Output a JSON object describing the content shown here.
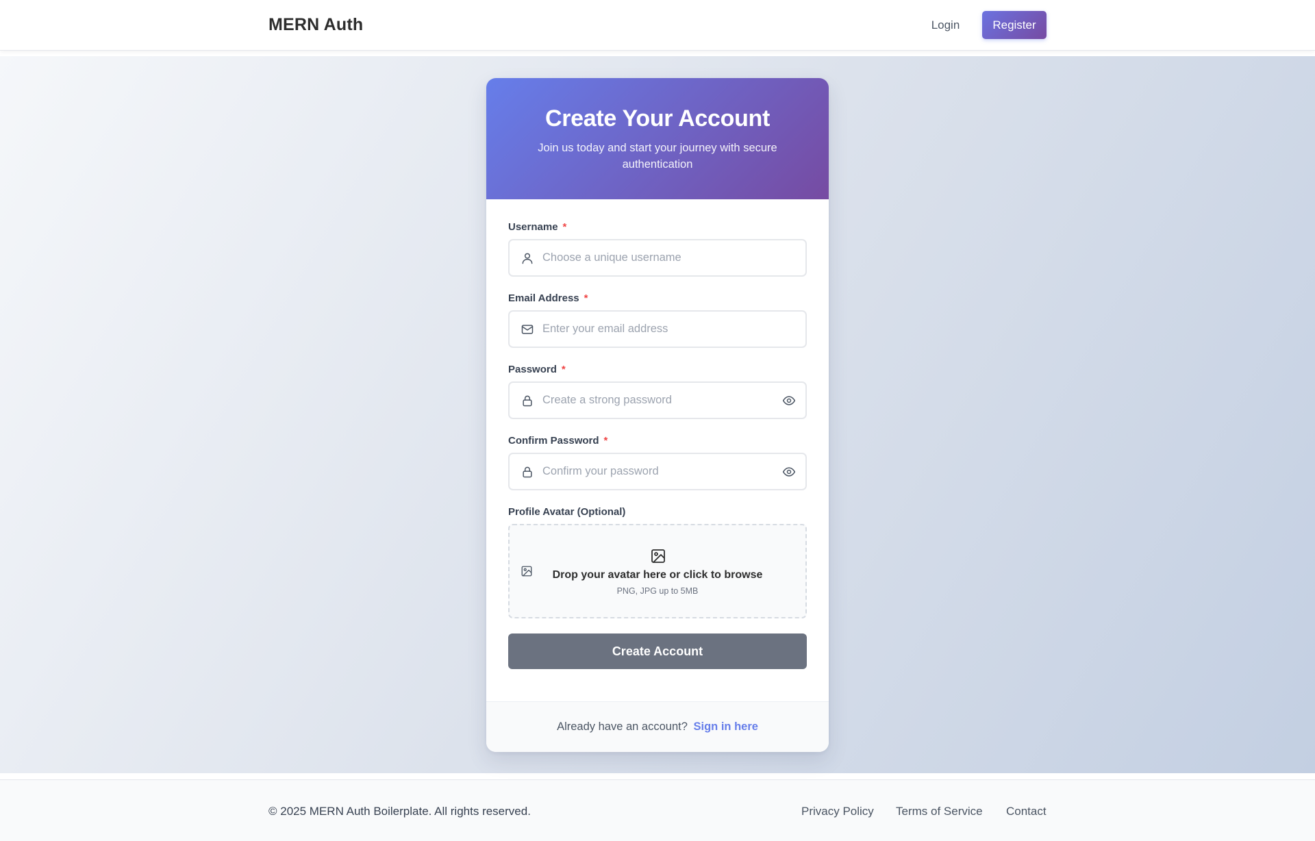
{
  "navbar": {
    "brand": "MERN Auth",
    "login_label": "Login",
    "register_label": "Register"
  },
  "card": {
    "title": "Create Your Account",
    "subtitle": "Join us today and start your journey with secure authentication",
    "fields": {
      "username": {
        "label": "Username",
        "required_mark": "*",
        "placeholder": "Choose a unique username",
        "value": "",
        "icon": "user-icon"
      },
      "email": {
        "label": "Email Address",
        "required_mark": "*",
        "placeholder": "Enter your email address",
        "value": "",
        "icon": "mail-icon"
      },
      "password": {
        "label": "Password",
        "required_mark": "*",
        "placeholder": "Create a strong password",
        "value": "",
        "icon": "lock-icon",
        "toggle_icon": "eye-icon"
      },
      "confirm_password": {
        "label": "Confirm Password",
        "required_mark": "*",
        "placeholder": "Confirm your password",
        "value": "",
        "icon": "lock-icon",
        "toggle_icon": "eye-icon"
      }
    },
    "avatar": {
      "label": "Profile Avatar (Optional)",
      "drop_text": "Drop your avatar here or click to browse",
      "hint": "PNG, JPG up to 5MB",
      "icon": "image-icon"
    },
    "submit_label": "Create Account",
    "footer": {
      "text": "Already have an account?",
      "link": "Sign in here"
    }
  },
  "footer": {
    "copyright": "© 2025 MERN Auth Boilerplate. All rights reserved.",
    "links": [
      "Privacy Policy",
      "Terms of Service",
      "Contact"
    ]
  },
  "colors": {
    "accent_start": "#667eea",
    "accent_end": "#764ba2",
    "required": "#ef4444",
    "submit_disabled": "#6b7280"
  }
}
